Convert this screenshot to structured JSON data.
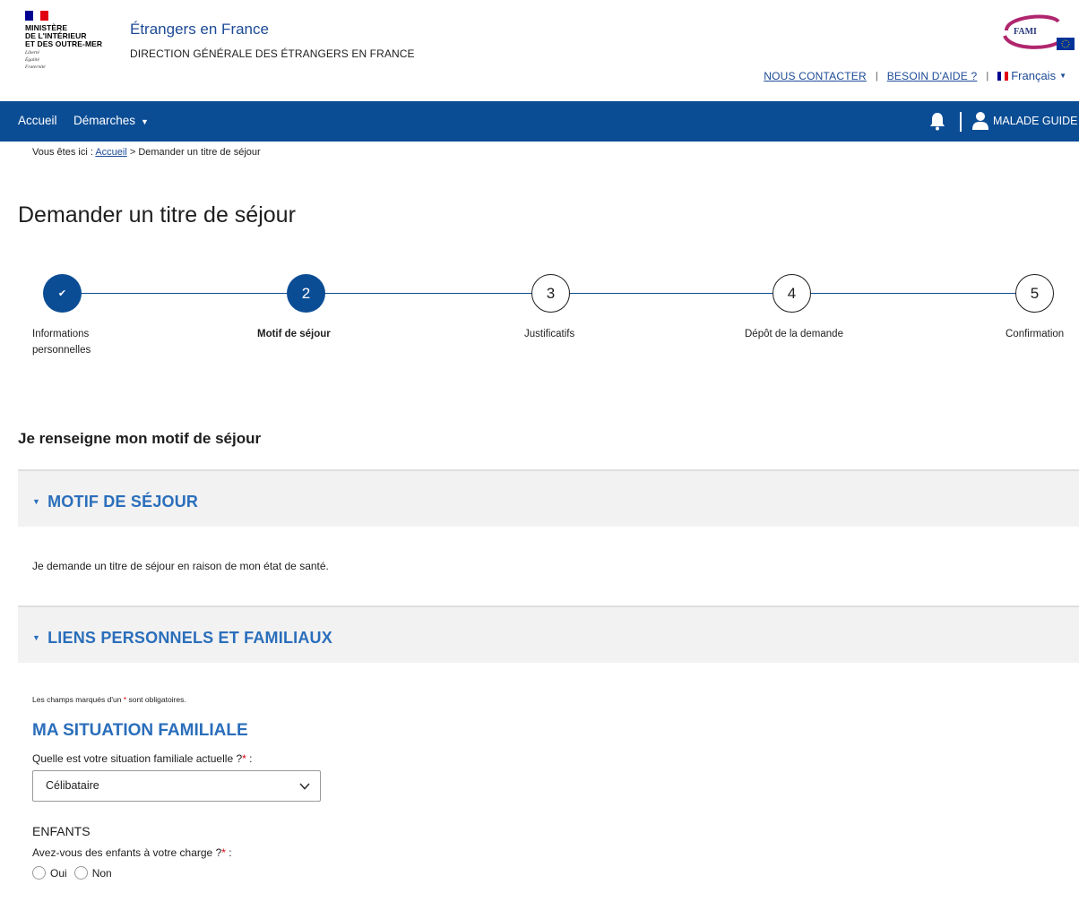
{
  "header": {
    "ministry_lines": [
      "MINISTÈRE",
      "DE L'INTÉRIEUR",
      "ET DES OUTRE-MER"
    ],
    "motto_lines": [
      "Liberté",
      "Égalité",
      "Fraternité"
    ],
    "site_title": "Étrangers en France",
    "site_subtitle": "DIRECTION GÉNÉRALE DES ÉTRANGERS EN FRANCE",
    "fami_logo_text": "FAMI",
    "contact_link": "NOUS CONTACTER",
    "help_link": "BESOIN D'AIDE ?",
    "separator": "|",
    "language": "Français"
  },
  "navbar": {
    "home": "Accueil",
    "demarches": "Démarches",
    "user_name": "MALADE GUIDE"
  },
  "breadcrumb": {
    "prefix": "Vous êtes ici : ",
    "home": "Accueil",
    "current": " > Demander un titre de séjour"
  },
  "page": {
    "title": "Demander un titre de séjour",
    "section_heading": "Je renseigne mon motif de séjour"
  },
  "stepper": {
    "steps": [
      {
        "number": "✔",
        "label_line1": "Informations",
        "label_line2": "personnelles",
        "state": "done"
      },
      {
        "number": "2",
        "label_line1": "Motif de séjour",
        "label_line2": "",
        "state": "active"
      },
      {
        "number": "3",
        "label_line1": "Justificatifs",
        "label_line2": "",
        "state": "todo"
      },
      {
        "number": "4",
        "label_line1": "Dépôt de la demande",
        "label_line2": "",
        "state": "todo"
      },
      {
        "number": "5",
        "label_line1": "Confirmation",
        "label_line2": "",
        "state": "todo"
      }
    ]
  },
  "panels": {
    "motif_title": "MOTIF DE SÉJOUR",
    "motif_text": "Je demande un titre de séjour en raison de mon état de santé.",
    "liens_title": "LIENS PERSONNELS ET FAMILIAUX"
  },
  "form": {
    "required_note_before": "Les champs marqués d'un ",
    "required_star": "*",
    "required_note_after": " sont obligatoires.",
    "situation_title": "MA SITUATION FAMILIALE",
    "situation_question": "Quelle est votre situation familiale actuelle ?",
    "situation_value": "Célibataire",
    "enfants_title": "ENFANTS",
    "enfants_question": "Avez-vous des enfants à votre charge ?",
    "label_suffix": " :",
    "option_yes": "Oui",
    "option_no": "Non"
  },
  "colors": {
    "navy": "#0b4d95",
    "link_blue": "#1c4a96",
    "heading_blue": "#2a6ebb",
    "required_red": "#e1000f",
    "panel_bg": "#f2f2f2"
  }
}
